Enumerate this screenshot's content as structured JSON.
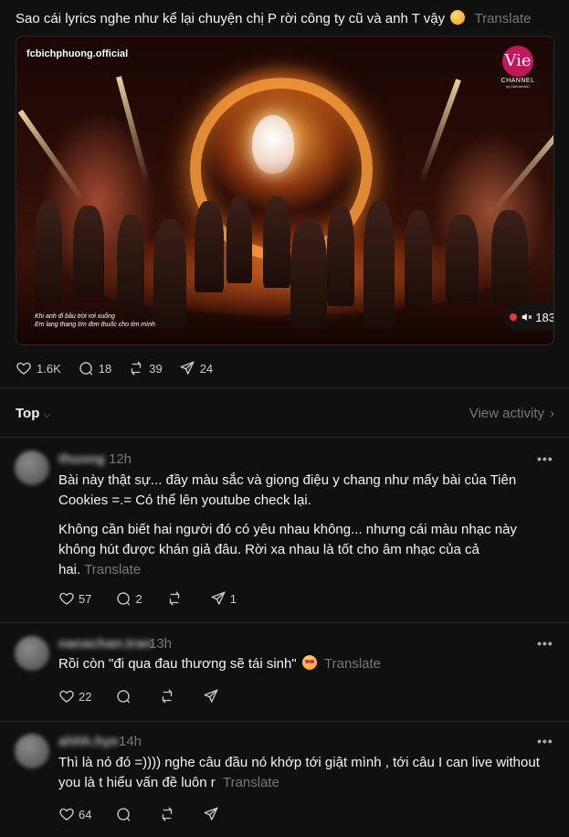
{
  "post": {
    "text": "Sao cái lyrics nghe như kể lại chuyện chị P rời công ty cũ và anh T vậy",
    "translate_label": "Translate",
    "video": {
      "channel_tag": "fcbichphuong.official",
      "logo_text": "Vie",
      "logo_channel": "CHANNEL",
      "logo_by": "by DatVietVAC",
      "lyric_line_1": "Khi anh đi bầu trời rơi xuống",
      "lyric_line_2": "Em lang thang tìm đơn thuốc cho tim mình",
      "view_count": "183"
    },
    "stats": {
      "likes": "1.6K",
      "comments": "18",
      "reposts": "39",
      "shares": "24"
    }
  },
  "sort": {
    "label": "Top",
    "view_activity": "View activity"
  },
  "comments": [
    {
      "username": "thuong",
      "time": "12h",
      "paragraphs": [
        "Bài này thật sự... đầy màu sắc và giọng điệu y chang như mấy bài của Tiên Cookies =.= Có thể lên youtube check lại.",
        "Không cần biết hai người đó có yêu nhau không... nhưng cái màu nhạc này không hút được khán giả đâu. Rời xa nhau là tốt cho âm nhạc của cả hai."
      ],
      "translate_label": "Translate",
      "likes": "57",
      "replies": "2",
      "reposts": "",
      "shares": "1"
    },
    {
      "username": "nanachan.tran",
      "time": "13h",
      "text": "Rồi còn \"đi qua đau thương sẽ tái sinh\"",
      "translate_label": "Translate",
      "likes": "22"
    },
    {
      "username": "ahhh.hye",
      "time": "14h",
      "text": "Thì là nó đó =)))) nghe câu đầu nó khớp tới giật mình , tới câu I can live without you là t hiểu vấn đề luôn r",
      "translate_label": "Translate",
      "likes": "64"
    }
  ],
  "more_label": "•••"
}
